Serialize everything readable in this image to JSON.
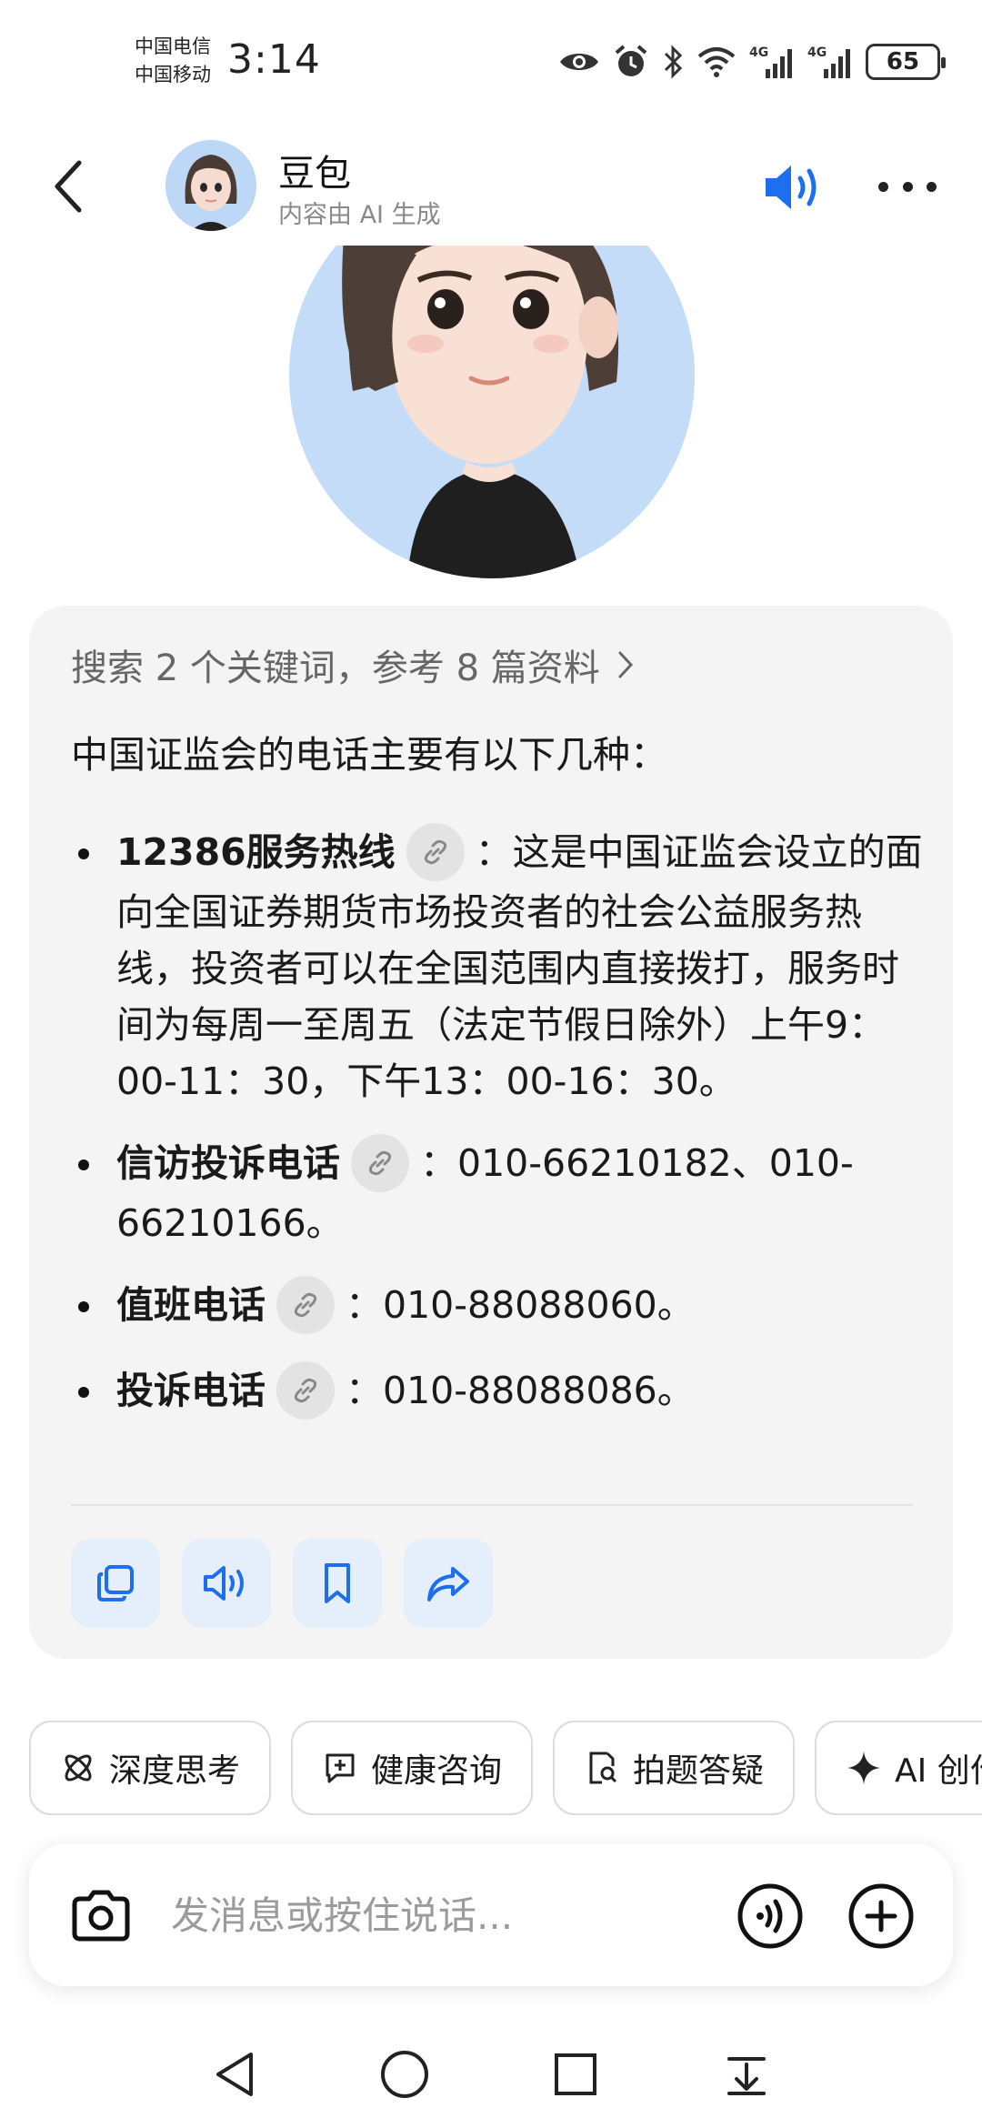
{
  "status_bar": {
    "carrier1": "中国电信",
    "carrier2": "中国移动",
    "time": "3:14",
    "battery": "65",
    "network1": "4G",
    "network2": "4G",
    "icons": [
      "eye-icon",
      "alarm-icon",
      "bluetooth-icon",
      "wifi-icon",
      "signal-icon",
      "signal-icon",
      "battery-icon"
    ]
  },
  "header": {
    "name": "豆包",
    "subtitle": "内容由 AI 生成",
    "accent": "#1e6ff0"
  },
  "answer": {
    "search_summary": "搜索 2 个关键词，参考 8 篇资料",
    "intro": "中国证监会的电话主要有以下几种：",
    "items": [
      {
        "title": "12386服务热线",
        "text": "：这是中国证监会设立的面向全国证券期货市场投资者的社会公益服务热线，投资者可以在全国范围内直接拨打，服务时间为每周一至周五（法定节假日除外）上午9：00-11：30，下午13：00-16：30。"
      },
      {
        "title": "信访投诉电话",
        "text": "：010-66210182、010-66210166。"
      },
      {
        "title": "值班电话",
        "text": "：010-88088060。"
      },
      {
        "title": "投诉电话",
        "text": "：010-88088086。"
      }
    ],
    "actions": [
      "copy-icon",
      "speaker-icon",
      "bookmark-icon",
      "share-icon"
    ]
  },
  "chips": [
    {
      "icon": "atom-icon",
      "label": "深度思考"
    },
    {
      "icon": "chat-plus-icon",
      "label": "健康咨询"
    },
    {
      "icon": "doc-search-icon",
      "label": "拍题答疑"
    },
    {
      "icon": "sparkle-icon",
      "label": "AI 创作"
    }
  ],
  "input": {
    "placeholder": "发消息或按住说话..."
  },
  "colors": {
    "card_bg": "#f4f4f4",
    "action_bg": "#e5eefb",
    "accent": "#1e6ff0"
  }
}
